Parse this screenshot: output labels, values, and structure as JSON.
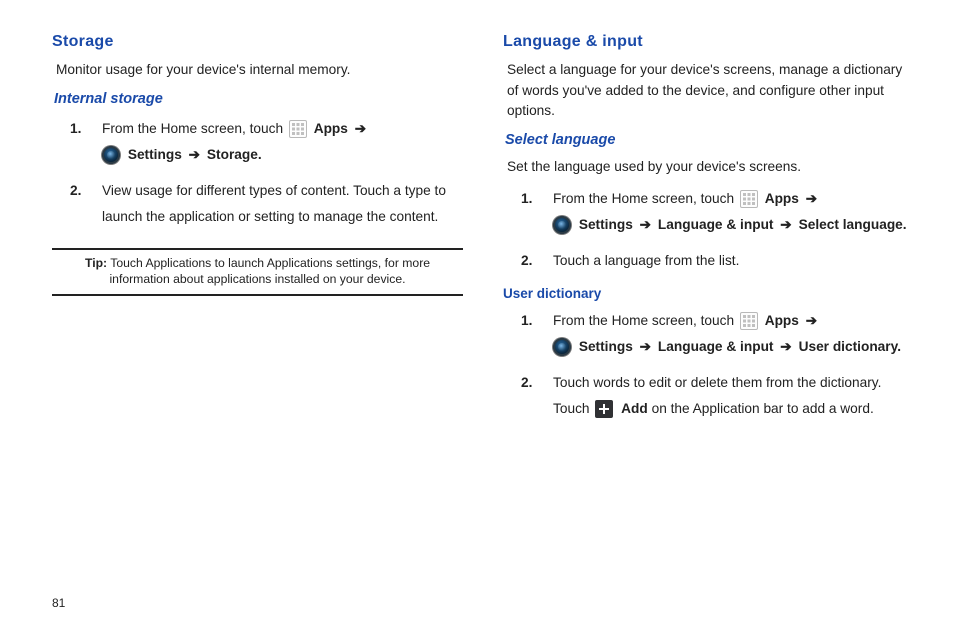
{
  "page_number": "81",
  "arrow": "➔",
  "common": {
    "from_home_touch": "From the Home screen, touch",
    "apps_label": "Apps",
    "settings_label": "Settings"
  },
  "left": {
    "heading": "Storage",
    "desc": "Monitor usage for your device's internal memory.",
    "sub_heading": "Internal storage",
    "step1_path_last": "Storage",
    "step2": "View usage for different types of content. Touch a type to launch the application or setting to manage the content.",
    "tip_label": "Tip:",
    "tip_body": "Touch Applications to launch Applications settings, for more information about applications installed on your device."
  },
  "right": {
    "heading": "Language & input",
    "desc": "Select a language for your device's screens, manage a dictionary of words you've added to the device, and configure other input options.",
    "select_lang": {
      "heading": "Select language",
      "desc": "Set the language used by your device's screens.",
      "step1_mid": "Language & input",
      "step1_last": "Select language",
      "step2": "Touch a language from the list."
    },
    "user_dict": {
      "heading": "User dictionary",
      "step1_mid": "Language & input",
      "step1_last": "User dictionary",
      "step2_a": "Touch words to edit or delete them from the dictionary. Touch",
      "step2_add": "Add",
      "step2_b": "on the Application bar to add a word."
    }
  }
}
